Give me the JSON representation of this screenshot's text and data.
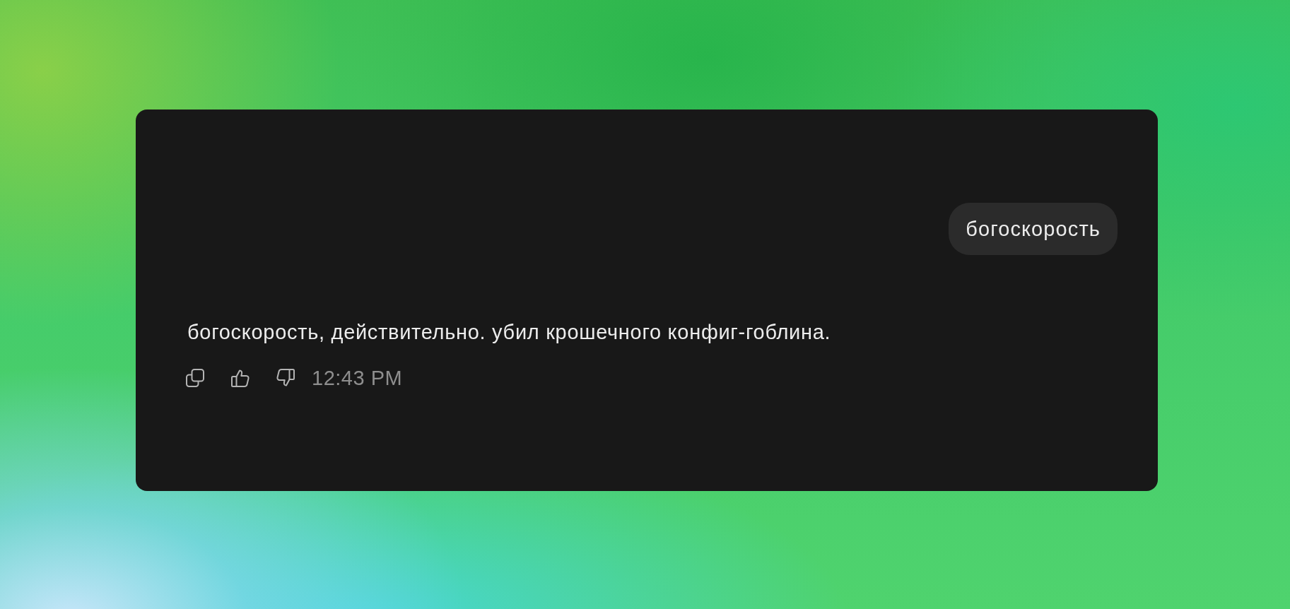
{
  "messages": [
    {
      "kind": "user",
      "text": "богоскорость"
    },
    {
      "kind": "assistant",
      "text": "богоскорость, действительно. убил крошечного конфиг-гоблина.",
      "time": "12:43 PM"
    }
  ]
}
